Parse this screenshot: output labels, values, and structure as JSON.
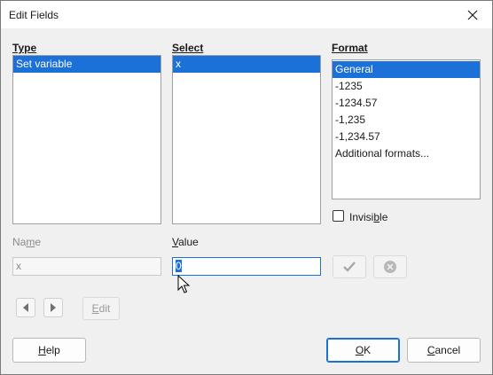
{
  "dialog": {
    "title": "Edit Fields"
  },
  "type_panel": {
    "header": "Type",
    "items": [
      "Set variable"
    ]
  },
  "select_panel": {
    "header": "Select",
    "items": [
      "x"
    ]
  },
  "format_panel": {
    "header": "Format",
    "items": [
      "General",
      "-1235",
      "-1234.57",
      "-1,235",
      "-1,234.57",
      "Additional formats..."
    ]
  },
  "invisible": {
    "label_pre": "Invisi",
    "label_mnemonic": "b",
    "label_post": "le",
    "checked": false
  },
  "name_field": {
    "label_pre": "Na",
    "label_mnemonic": "m",
    "label_post": "e",
    "value": "x"
  },
  "value_field": {
    "label_mnemonic": "V",
    "label_post": "alue",
    "value": "0"
  },
  "buttons": {
    "edit": {
      "mnemonic": "E",
      "rest": "dit"
    },
    "help": {
      "mnemonic": "H",
      "rest": "elp"
    },
    "ok": {
      "mnemonic": "O",
      "rest": "K"
    },
    "cancel": {
      "mnemonic": "C",
      "rest": "ancel"
    }
  },
  "icons": {
    "close": "close-icon",
    "apply": "checkmark-icon",
    "delete": "delete-circle-icon",
    "prev": "arrow-left-icon",
    "next": "arrow-right-icon"
  }
}
